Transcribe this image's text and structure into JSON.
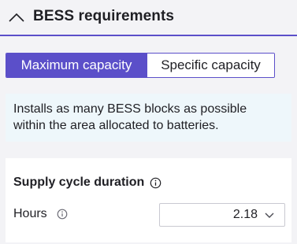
{
  "header": {
    "title": "BESS requirements",
    "collapse_icon": "chevron-up-icon"
  },
  "mode_toggle": {
    "options": [
      "Maximum capacity",
      "Specific capacity"
    ],
    "selected": "Maximum capacity"
  },
  "info": {
    "line1": "Installs as many BESS blocks as possible",
    "line2": "within the area allocated to batteries."
  },
  "supply_cycle": {
    "title": "Supply cycle duration",
    "title_icon": "info-icon",
    "hours_label": "Hours",
    "hours_icon": "info-icon",
    "hours_value": "2.18",
    "dropdown_icon": "chevron-down-icon"
  },
  "colors": {
    "accent": "#5b4fc9",
    "info_bg": "#eef7fb",
    "page_bg": "#f3f3f6"
  }
}
